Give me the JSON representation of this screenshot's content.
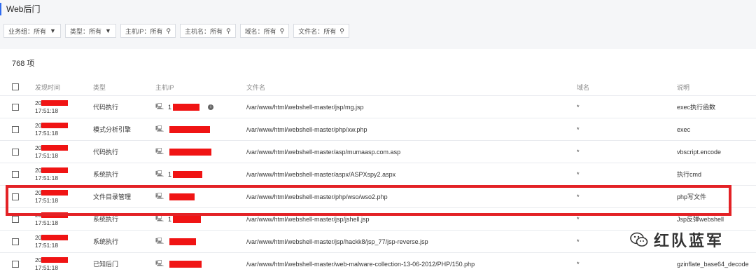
{
  "page": {
    "title": "Web后门"
  },
  "filters": [
    {
      "label": "业务组：所有",
      "icon": "filter-icon"
    },
    {
      "label": "类型：所有",
      "icon": "filter-icon"
    },
    {
      "label": "主机IP：所有",
      "icon": "search-icon"
    },
    {
      "label": "主机名：所有",
      "icon": "search-icon"
    },
    {
      "label": "域名：所有",
      "icon": "search-icon"
    },
    {
      "label": "文件名：所有",
      "icon": "search-icon"
    }
  ],
  "table": {
    "count": "768 项",
    "columns": {
      "time": "发现时间",
      "type": "类型",
      "ip": "主机IP",
      "file": "文件名",
      "domain": "域名",
      "desc": "说明"
    },
    "rows": [
      {
        "year": "20",
        "time": "17:51:18",
        "type": "代码执行",
        "ip_prefix": "1",
        "file": "/var/www/html/webshell-master/jsp/mg.jsp",
        "domain": "*",
        "desc": "exec执行函数",
        "info": true
      },
      {
        "year": "20",
        "time": "17:51:18",
        "type": "模式分析引擎",
        "ip_prefix": "",
        "file": "/var/www/html/webshell-master/php/xw.php",
        "domain": "*",
        "desc": "exec",
        "info": false
      },
      {
        "year": "20",
        "time": "17:51:18",
        "type": "代码执行",
        "ip_prefix": "",
        "file": "/var/www/html/webshell-master/asp/mumaasp.com.asp",
        "domain": "*",
        "desc": "vbscript.encode",
        "info": false
      },
      {
        "year": "20",
        "time": "17:51:18",
        "type": "系统执行",
        "ip_prefix": "1",
        "file": "/var/www/html/webshell-master/aspx/ASPXspy2.aspx",
        "domain": "*",
        "desc": "执行cmd",
        "info": false
      },
      {
        "year": "20",
        "time": "17:51:18",
        "type": "文件目录管理",
        "ip_prefix": "",
        "file": "/var/www/html/webshell-master/php/wso/wso2.php",
        "domain": "*",
        "desc": "php写文件",
        "info": false
      },
      {
        "year": "20",
        "time": "17:51:18",
        "type": "系统执行",
        "ip_prefix": "1",
        "file": "/var/www/html/webshell-master/jsp/jshell.jsp",
        "domain": "*",
        "desc": "Jsp反弹webshell",
        "info": false
      },
      {
        "year": "20",
        "time": "17:51:18",
        "type": "系统执行",
        "ip_prefix": "",
        "file": "/var/www/html/webshell-master/jsp/hackk8/jsp_77/jsp-reverse.jsp",
        "domain": "*",
        "desc": "",
        "info": false
      },
      {
        "year": "20",
        "time": "17:51:18",
        "type": "已知后门",
        "ip_prefix": "",
        "file": "/var/www/html/webshell-master/web-malware-collection-13-06-2012/PHP/150.php",
        "domain": "*",
        "desc": "gzinflate_base64_decode",
        "info": false
      }
    ]
  },
  "watermark": {
    "text": "红队蓝军",
    "icon": "wechat-icon"
  },
  "colors": {
    "accent": "#2f6bf0",
    "highlight": "#e32226",
    "redaction": "#f01414"
  }
}
